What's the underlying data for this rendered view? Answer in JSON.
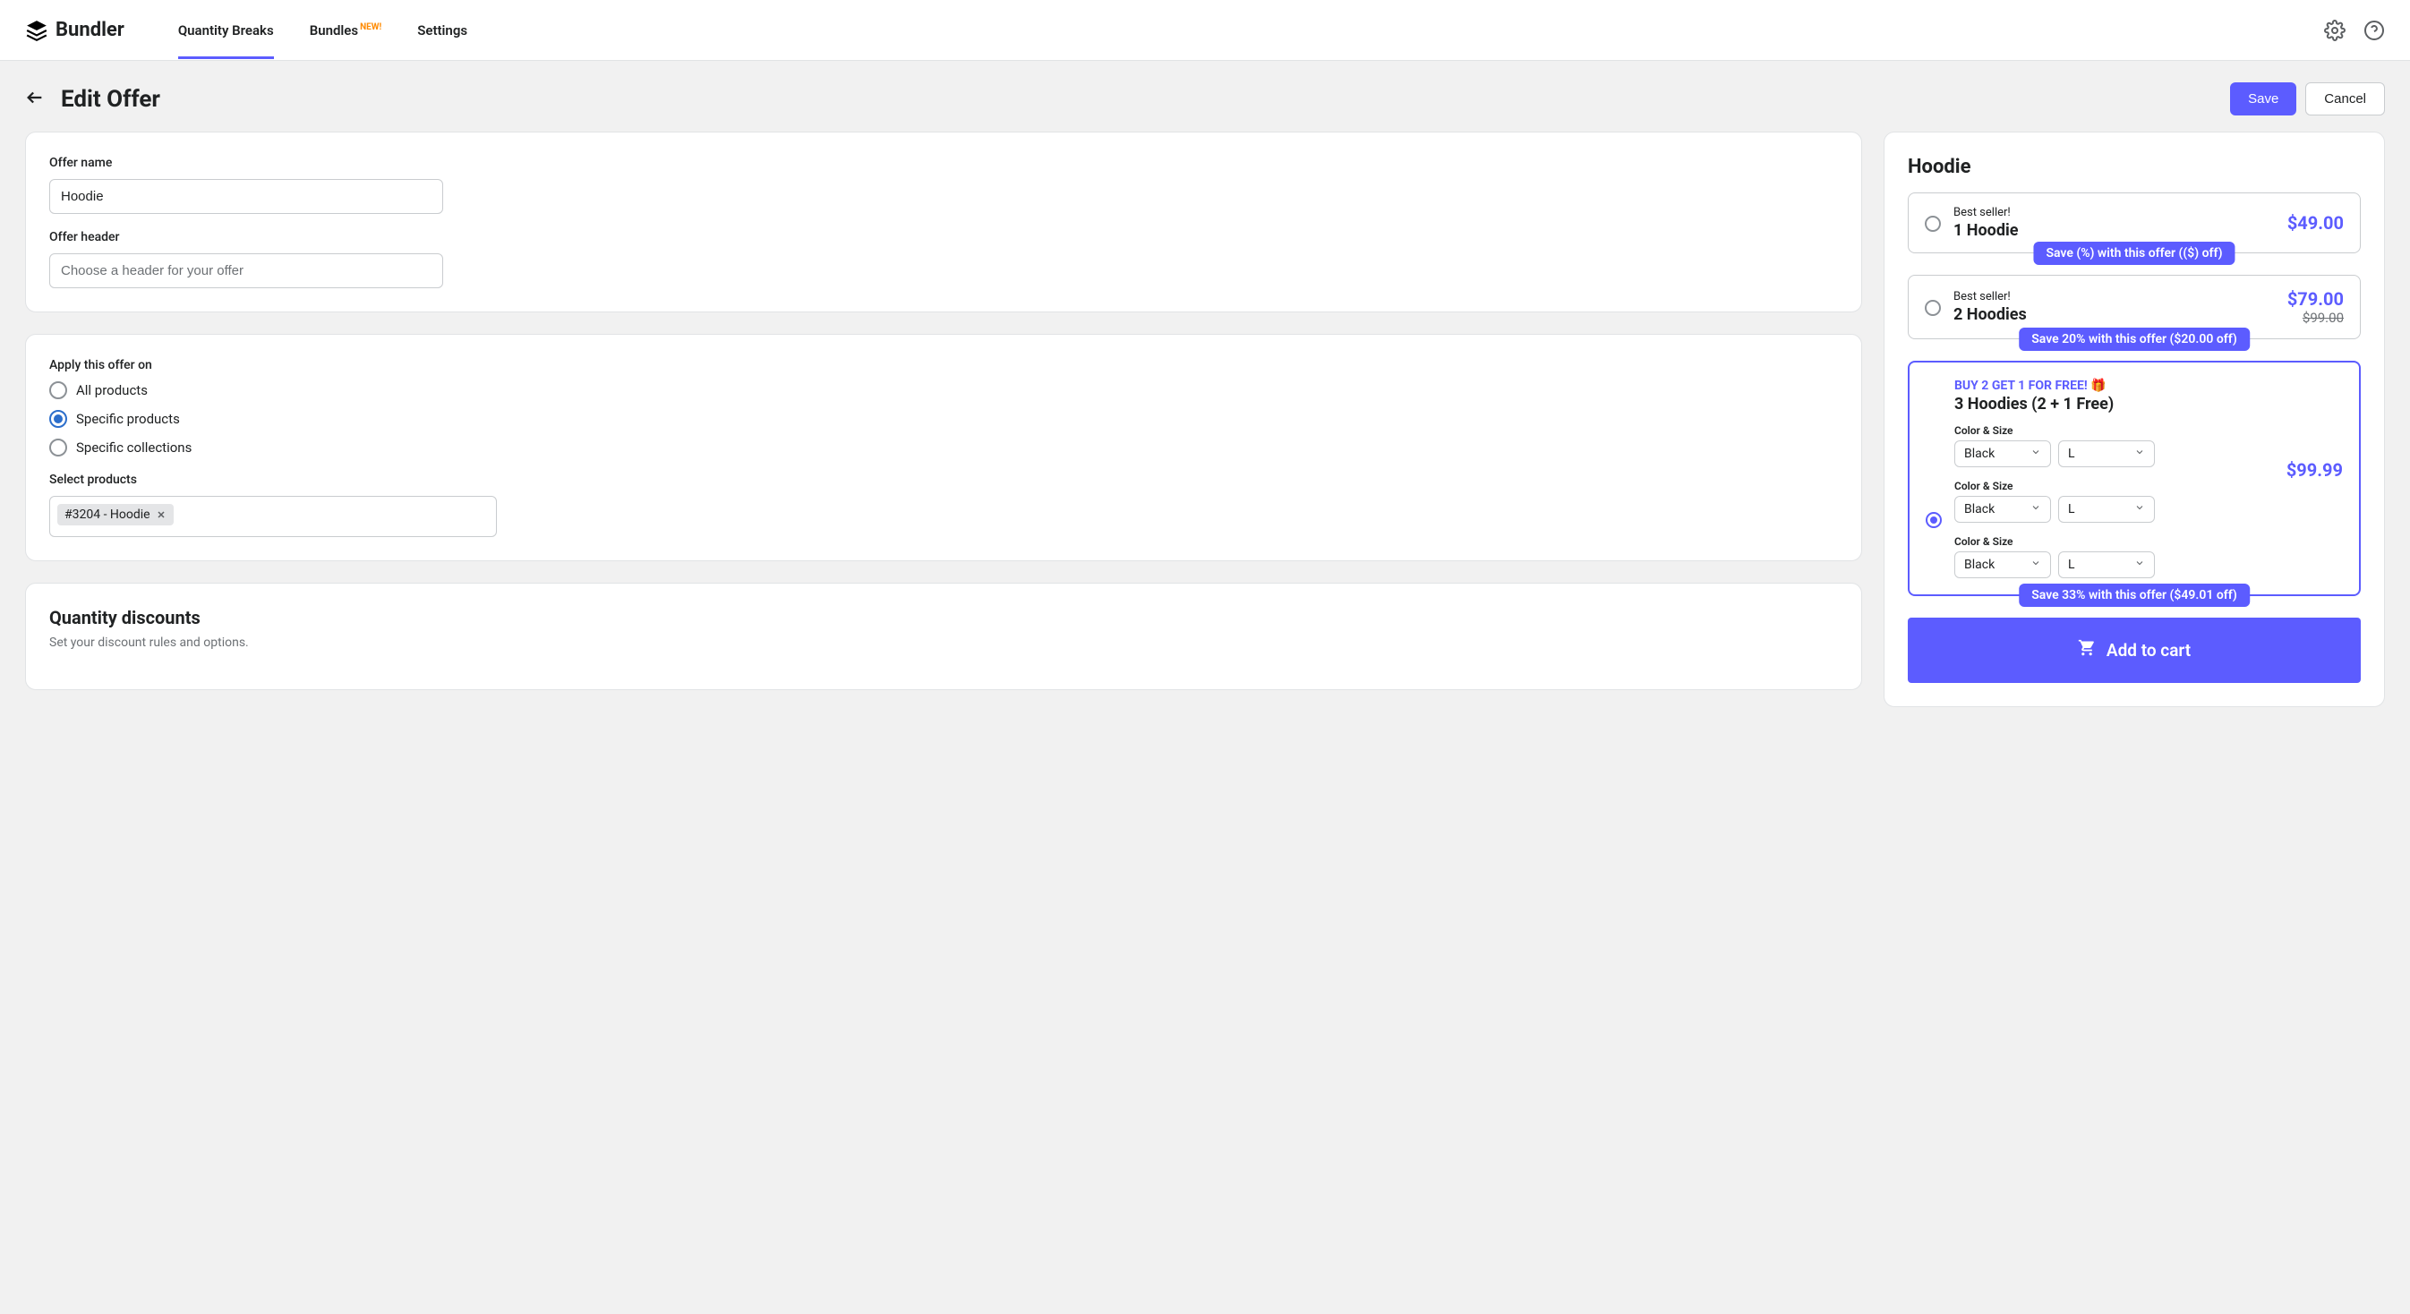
{
  "brand": "Bundler",
  "nav": {
    "quantity_breaks": "Quantity Breaks",
    "bundles": "Bundles",
    "bundles_badge": "NEW!",
    "settings": "Settings"
  },
  "page": {
    "title": "Edit Offer",
    "save": "Save",
    "cancel": "Cancel"
  },
  "form": {
    "offer_name_label": "Offer name",
    "offer_name_value": "Hoodie",
    "offer_header_label": "Offer header",
    "offer_header_placeholder": "Choose a header for your offer",
    "apply_label": "Apply this offer on",
    "apply_options": {
      "all": "All products",
      "specific_products": "Specific products",
      "specific_collections": "Specific collections"
    },
    "select_products_label": "Select products",
    "selected_product_tag": "#3204 - Hoodie",
    "quantity_discounts_title": "Quantity discounts",
    "quantity_discounts_sub": "Set your discount rules and options."
  },
  "preview": {
    "title": "Hoodie",
    "tiers": [
      {
        "tag": "Best seller!",
        "name": "1 Hoodie",
        "price": "$49.00",
        "save_text": "Save (%) with this offer (($) off)"
      },
      {
        "tag": "Best seller!",
        "name": "2 Hoodies",
        "price": "$79.00",
        "old_price": "$99.00",
        "save_text": "Save 20% with this offer ($20.00 off)"
      },
      {
        "promo": "BUY 2 GET 1 FOR FREE! 🎁",
        "name": "3 Hoodies (2 + 1 Free)",
        "price": "$99.99",
        "variant_label": "Color & Size",
        "color": "Black",
        "size": "L",
        "save_text": "Save 33% with this offer ($49.01 off)"
      }
    ],
    "add_to_cart": "Add to cart"
  }
}
